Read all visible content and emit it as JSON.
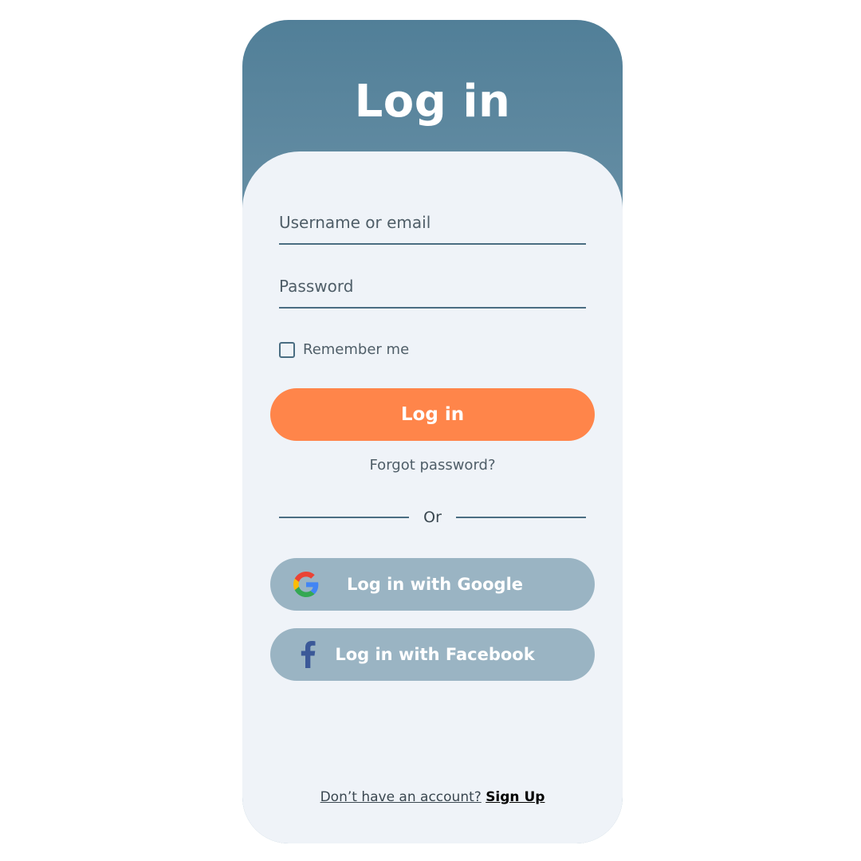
{
  "header": {
    "title": "Log in"
  },
  "form": {
    "username_placeholder": "Username or email",
    "password_placeholder": "Password",
    "remember_label": "Remember me",
    "remember_checked": false,
    "submit_label": "Log in",
    "forgot_label": "Forgot password?"
  },
  "divider": {
    "label": "Or"
  },
  "social": {
    "google_label": "Log in with Google",
    "google_icon": "google-icon",
    "facebook_label": "Log in with Facebook",
    "facebook_icon": "facebook-icon"
  },
  "footer": {
    "prompt": "Don’t  have an account?",
    "signup_label": "Sign Up"
  },
  "colors": {
    "header_gradient_top": "#517f98",
    "header_gradient_bottom": "#9bb6c4",
    "card_background": "#eff3f8",
    "primary_button": "#ff854a",
    "social_button": "#9ab4c3",
    "underline": "#4a6d82",
    "facebook_blue": "#3b5998"
  }
}
